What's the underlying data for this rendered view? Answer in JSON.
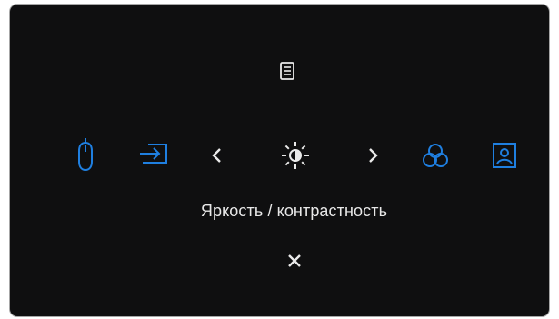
{
  "osd": {
    "title": "Яркость / контрастность"
  },
  "icons": {
    "top": "menu-icon",
    "row": [
      "mouse-icon",
      "input-source-icon",
      "chevron-left-icon",
      "brightness-icon",
      "chevron-right-icon",
      "color-icon",
      "display-icon"
    ],
    "bottom": "close-icon"
  },
  "colors": {
    "background": "#0f0f10",
    "text": "#e8e8e8",
    "accent": "#1f7fe0"
  }
}
